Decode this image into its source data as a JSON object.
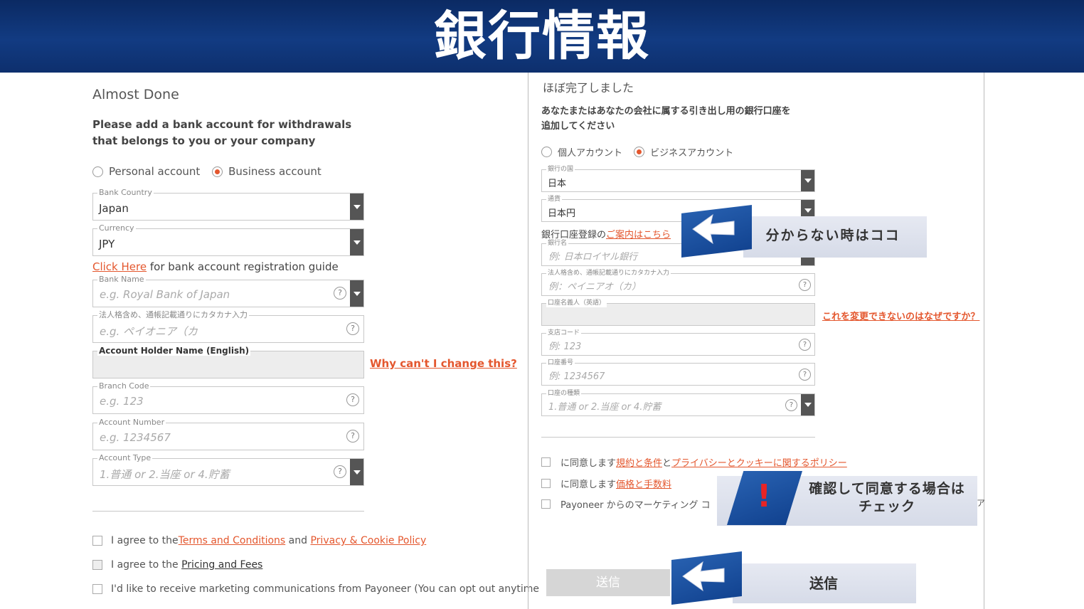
{
  "banner": {
    "title": "銀行情報"
  },
  "english": {
    "title": "Almost Done",
    "subtitle": "Please add a bank account for withdrawals that belongs to you or your company",
    "account_types": [
      {
        "label": "Personal account",
        "selected": false
      },
      {
        "label": "Business account",
        "selected": true
      }
    ],
    "bank_country": {
      "label": "Bank Country",
      "value": "Japan"
    },
    "currency": {
      "label": "Currency",
      "value": "JPY"
    },
    "guide": {
      "link": "Click Here",
      "text": " for bank account registration guide"
    },
    "bank_name": {
      "label": "Bank Name",
      "placeholder": "e.g. Royal Bank of Japan"
    },
    "katakana": {
      "label": "法人格含め、通帳記載通りにカタカナ入力",
      "placeholder": "e.g. ペイオニア（カ"
    },
    "holder_name": {
      "label": "Account Holder Name (English)"
    },
    "why_link": "Why can't I change this?",
    "branch_code": {
      "label": "Branch Code",
      "placeholder": "e.g. 123"
    },
    "account_number": {
      "label": "Account Number",
      "placeholder": "e.g. 1234567"
    },
    "account_type": {
      "label": "Account Type",
      "placeholder": "1.普通 or 2.当座 or 4.貯蓄"
    },
    "agree_terms": {
      "prefix": "I agree to the ",
      "link1": "Terms and Conditions",
      "mid": " and ",
      "link2": "Privacy & Cookie Policy"
    },
    "agree_pricing": {
      "prefix": "I agree to the ",
      "link": "Pricing and Fees"
    },
    "marketing": "I'd like to receive marketing communications from Payoneer (You can opt out anytime",
    "help_glyph": "?"
  },
  "japanese": {
    "title": "ほぼ完了しました",
    "subtitle_line1": "あなたまたはあなたの会社に属する引き出し用の銀行口座を",
    "subtitle_line2": "追加してください",
    "account_types": [
      {
        "label": "個人アカウント",
        "selected": false
      },
      {
        "label": "ビジネスアカウント",
        "selected": true
      }
    ],
    "bank_country": {
      "label": "銀行の国",
      "value": "日本"
    },
    "currency": {
      "label": "通貨",
      "value": "日本円"
    },
    "guide": {
      "text": "銀行口座登録の",
      "link": "ご案内はこちら"
    },
    "bank_name": {
      "label": "銀行名",
      "placeholder": "例: 日本ロイヤル銀行"
    },
    "katakana": {
      "label": "法人格含め、通帳記載通りにカタカナ入力",
      "placeholder": "例：ペイニアオ（カ）"
    },
    "holder_name": {
      "label": "口座名義人（英語）"
    },
    "why_link": "これを変更できないのはなぜですか？",
    "branch_code": {
      "label": "支店コード",
      "placeholder": "例: 123"
    },
    "account_number": {
      "label": "口座番号",
      "placeholder": "例: 1234567"
    },
    "account_type": {
      "label": "口座の種類",
      "placeholder": "1.普通 or 2.当座 or 4.貯蓄"
    },
    "agree_terms": {
      "prefix": "に同意します",
      "link1": "規約と条件",
      "mid": "と",
      "link2": "プライバシーとクッキーに関するポリシー"
    },
    "agree_pricing": {
      "prefix": "に同意します",
      "link": "価格と手数料"
    },
    "marketing": "Payoneer からのマーケティング コ",
    "marketing_tail": "ア",
    "submit": "送信"
  },
  "callouts": {
    "unknown": "分からない時はココ",
    "confirm_line1": "確認して同意する場合は",
    "confirm_line2": "チェック",
    "exclaim": "!",
    "submit": "送信"
  }
}
